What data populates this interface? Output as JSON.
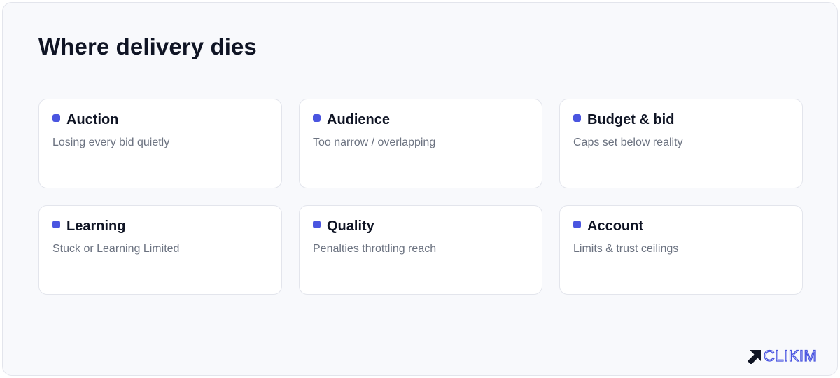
{
  "title": "Where delivery dies",
  "accent_color": "#4a55e0",
  "cards": [
    {
      "title": "Auction",
      "desc": "Losing every bid quietly"
    },
    {
      "title": "Audience",
      "desc": "Too narrow / overlapping"
    },
    {
      "title": "Budget & bid",
      "desc": "Caps set below reality"
    },
    {
      "title": "Learning",
      "desc": "Stuck or Learning Limited"
    },
    {
      "title": "Quality",
      "desc": "Penalties throttling reach"
    },
    {
      "title": "Account",
      "desc": "Limits & trust ceilings"
    }
  ],
  "logo": {
    "text": "CLIKIM",
    "icon": "arrow-up-right-icon"
  }
}
